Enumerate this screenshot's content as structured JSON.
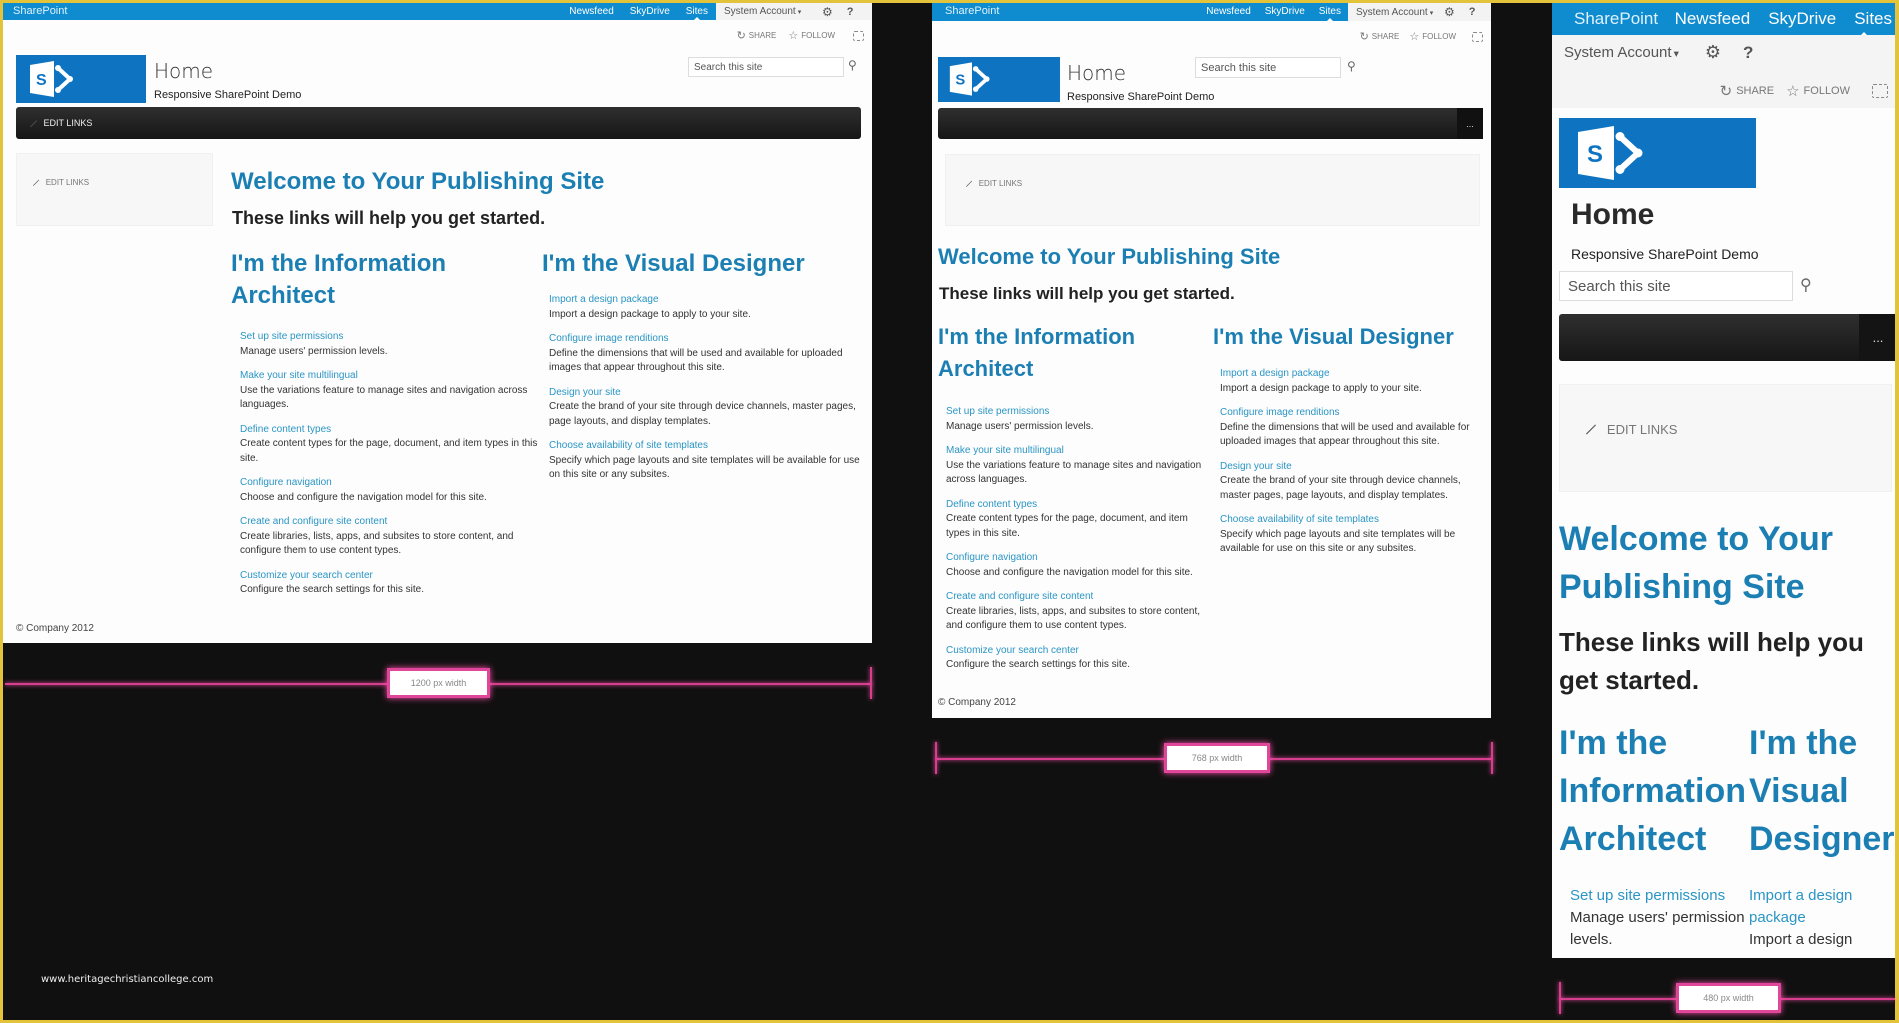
{
  "common": {
    "brand": "SharePoint",
    "nav_links": [
      "Newsfeed",
      "SkyDrive",
      "Sites"
    ],
    "account": "System Account",
    "help": "?",
    "share": "SHARE",
    "follow": "FOLLOW",
    "site_title": "Home",
    "site_subtitle": "Responsive SharePoint Demo",
    "search_placeholder": "Search this site",
    "edit_links": "EDIT LINKS",
    "more": "...",
    "welcome_heading": "Welcome to Your Publishing Site",
    "lead": "These links will help you get started.",
    "footer": "© Company 2012"
  },
  "columns": [
    {
      "heading": "I'm the Information Architect",
      "items": [
        {
          "link": "Set up site permissions",
          "desc": "Manage users' permission levels."
        },
        {
          "link": "Make your site multilingual",
          "desc": "Use the variations feature to manage sites and navigation across languages."
        },
        {
          "link": "Define content types",
          "desc": "Create content types for the page, document, and item types in this site."
        },
        {
          "link": "Configure navigation",
          "desc": "Choose and configure the navigation model for this site."
        },
        {
          "link": "Create and configure site content",
          "desc": "Create libraries, lists, apps, and subsites to store content, and configure them to use content types."
        },
        {
          "link": "Customize your search center",
          "desc": "Configure the search settings for this site."
        }
      ]
    },
    {
      "heading": "I'm the Visual Designer",
      "items": [
        {
          "link": "Import a design package",
          "desc": "Import a design package to apply to your site."
        },
        {
          "link": "Configure image renditions",
          "desc": "Define the dimensions that will be used and available for uploaded images that appear throughout this site."
        },
        {
          "link": "Design your site",
          "desc": "Create the brand of your site through device channels, master pages, page layouts, and display templates."
        },
        {
          "link": "Choose availability of site templates",
          "desc": "Specify which page layouts and site templates will be available for use on this site or any subsites."
        }
      ]
    }
  ],
  "mobile_partial": {
    "colA_item": {
      "link": "Set up site permissions",
      "desc": "Manage users' permission levels."
    },
    "colB_item": {
      "link": "Import a design package",
      "desc": "Import a design"
    }
  },
  "rulers": [
    "1200 px width",
    "768 px width",
    "480 px width"
  ],
  "watermark": "www.heritagechristiancollege.com",
  "colors": {
    "suitebar": "#0f8bcf",
    "logo": "#0e74c2",
    "heading": "#1c7fb3",
    "link": "#2a95c5",
    "ruler": "#d63f8e",
    "frame": "#e3c33a"
  }
}
